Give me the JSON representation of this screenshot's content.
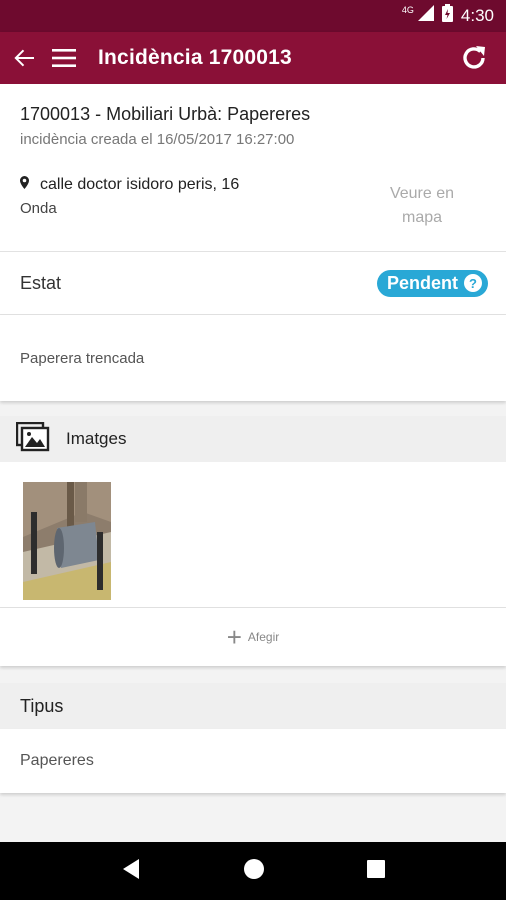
{
  "statusbar": {
    "network": "4G",
    "time": "4:30"
  },
  "appbar": {
    "title": "Incidència 1700013"
  },
  "incident": {
    "title": "1700013 - Mobiliari Urbà: Papereres",
    "created": "incidència creada el 16/05/2017 16:27:00",
    "address": "calle doctor isidoro peris, 16",
    "city": "Onda",
    "map_link": "Veure en mapa"
  },
  "estat": {
    "label": "Estat",
    "status": "Pendent",
    "help": "?"
  },
  "description": "Paperera trencada",
  "images": {
    "label": "Imatges",
    "add_label": "Afegir"
  },
  "tipus": {
    "label": "Tipus",
    "value": "Papereres"
  },
  "colors": {
    "appbar": "#8a1037",
    "statusbar": "#6e0a2e",
    "status_pill": "#29a8d6"
  }
}
